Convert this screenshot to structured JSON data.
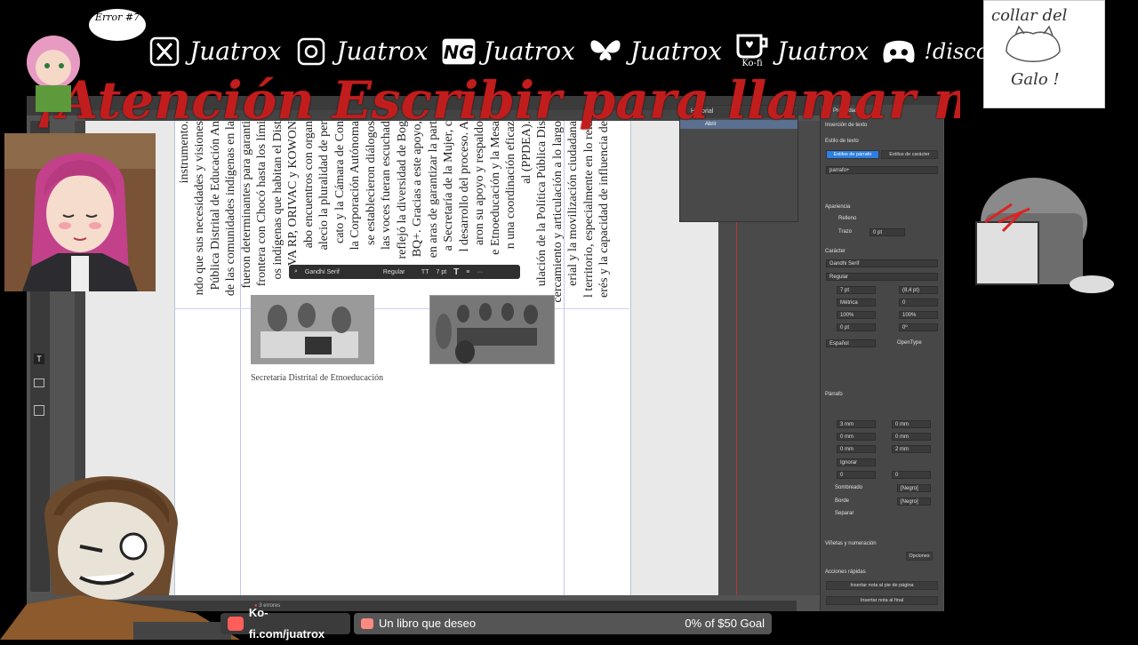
{
  "overlay": {
    "error_badge": "Error #7",
    "socials": [
      {
        "icon": "x-icon",
        "handle": "Juatrox"
      },
      {
        "icon": "instagram-icon",
        "handle": "Juatrox"
      },
      {
        "icon": "newgrounds-icon",
        "handle": "Juatrox"
      },
      {
        "icon": "bluesky-icon",
        "handle": "Juatrox"
      },
      {
        "icon": "kofi-icon",
        "handle": "Juatrox",
        "sub": "Ko-fi"
      },
      {
        "icon": "discord-icon",
        "handle": "!discord"
      }
    ],
    "banner": "¡Atención Escribir para llamar m",
    "note_lines": [
      "collar del",
      "Galo !"
    ],
    "accent": "#c21d1d"
  },
  "indesign": {
    "history_panel": {
      "title": "Historial",
      "row": "Abrir"
    },
    "control_bar": {
      "font": "Gandhi Serif",
      "style": "Regular",
      "size": "7 pt"
    },
    "columns": [
      "instrumento.",
      "ndo que sus necesidades y visiones",
      "Pública Distrital de Educación An",
      "de las comunidades indígenas en la",
      "fueron determinantes para garanti",
      "frontera con Chocó hasta los lími",
      "os indígenas que habitan el Dist",
      "VA RP, ORIVAC y KOWON",
      "abo encuentros con organ",
      "alecio la pluralidad de per",
      "cato y la Cámara de Con",
      "la Corporación Autónoma",
      "se establecieron diálogos",
      "las voces fueran escuchad",
      "reflejó la diversidad de Bog",
      "BQ+. Gracias a este apoyo,",
      "en aras de garantizar la part",
      "a Secretaría de la Mujer, c",
      "l desarrollo del proceso. A",
      "aron su apoyo y respaldo",
      "e Etnoeducación y la Mesa",
      "n una coordinación eficaz",
      "al (PPDEA).",
      "ulación de la Política Pública Dis",
      "cercamiento y articulación a lo largo",
      "erial y la movilización ciudadana",
      "l territorio, especialmente en lo rela",
      "erés y la capacidad de influencia de"
    ],
    "caption": "Secretaría Distrital de Etnoeducación",
    "status": "3 errores",
    "properties": {
      "tab": "Propiedades",
      "insercion": "Inserción de texto",
      "estilo_texto": "Estilo de texto",
      "tab_parrafo": "Estilos de párrafo",
      "tab_caracter": "Estilos de carácter",
      "style_value": "parrafo+",
      "apariencia": "Apariencia",
      "relleno": "Relleno",
      "trazo": "Trazo",
      "trazo_val": "0 pt",
      "caracter": "Carácter",
      "font": "Gandhi Serif",
      "font_style": "Regular",
      "size": "7 pt",
      "leading": "(8,4 pt)",
      "kerning": "Métrica",
      "tracking": "0",
      "v_scale": "100%",
      "h_scale": "100%",
      "baseline": "0 pt",
      "skew": "0º",
      "language": "Español",
      "opentype": "OpenType",
      "parrafo": "Párrafo",
      "indent_left": "3 mm",
      "indent_right": "0 mm",
      "space_before": "0 mm",
      "space_after": "0 mm",
      "first_line": "0 mm",
      "last_line": "2 mm",
      "grid": "Ignorar",
      "drop_lines": "0",
      "drop_chars": "0",
      "sombreado": "Sombreado",
      "borde": "Borde",
      "separar": "Separar",
      "swatch": "[Negro]",
      "vinetas": "Viñetas y numeración",
      "opciones": "Opciones",
      "acciones": "Acciones rápidas",
      "nota_pie": "Insertar nota al pie de página",
      "nota_final": "Insertar nota al final"
    }
  },
  "bottom_bar": {
    "kofi": "Ko-fi.com/juatrox",
    "wish": "Un libro que deseo",
    "goal": "0% of $50 Goal",
    "goal_progress": 0
  }
}
